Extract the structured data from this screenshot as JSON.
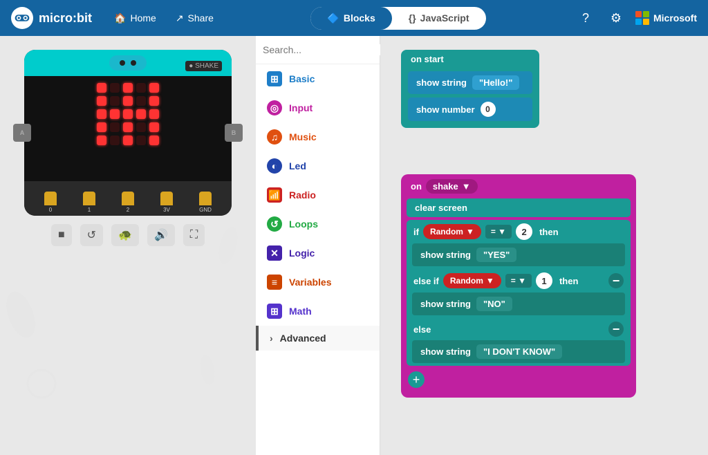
{
  "header": {
    "logo_text": "micro:bit",
    "home_label": "Home",
    "share_label": "Share",
    "blocks_label": "Blocks",
    "javascript_label": "JavaScript",
    "active_tab": "blocks"
  },
  "toolbox": {
    "search_placeholder": "Search...",
    "items": [
      {
        "id": "basic",
        "label": "Basic",
        "color": "#1e7ec8",
        "icon": "⊞"
      },
      {
        "id": "input",
        "label": "Input",
        "color": "#c020a0",
        "icon": "◎"
      },
      {
        "id": "music",
        "label": "Music",
        "color": "#e05010",
        "icon": "🎵"
      },
      {
        "id": "led",
        "label": "Led",
        "color": "#2244aa",
        "icon": "◐"
      },
      {
        "id": "radio",
        "label": "Radio",
        "color": "#cc2222",
        "icon": "📶"
      },
      {
        "id": "loops",
        "label": "Loops",
        "color": "#22aa44",
        "icon": "↺"
      },
      {
        "id": "logic",
        "label": "Logic",
        "color": "#4422aa",
        "icon": "✕"
      },
      {
        "id": "variables",
        "label": "Variables",
        "color": "#cc4400",
        "icon": "≡"
      },
      {
        "id": "math",
        "label": "Math",
        "color": "#5533cc",
        "icon": "⊞"
      },
      {
        "id": "advanced",
        "label": "Advanced",
        "color": "#333",
        "icon": "›"
      }
    ]
  },
  "blocks": {
    "on_start": {
      "header": "on start",
      "rows": [
        {
          "type": "show_string",
          "label": "show string",
          "value": "\"Hello!\""
        },
        {
          "type": "show_number",
          "label": "show number",
          "value": "0"
        }
      ]
    },
    "on_shake": {
      "header": "on",
      "event": "shake",
      "clear_screen": "clear screen",
      "if_block": {
        "keyword": "if",
        "condition_label": "Random",
        "operator": "=",
        "value": "2",
        "then": "then",
        "show_label": "show string",
        "show_value": "\"YES\""
      },
      "else_if_block": {
        "keyword": "else if",
        "condition_label": "Random",
        "operator": "=",
        "value": "1",
        "then": "then",
        "show_label": "show string",
        "show_value": "\"NO\""
      },
      "else_block": {
        "keyword": "else",
        "show_label": "show string",
        "show_value": "\"I DON'T KNOW\""
      }
    }
  },
  "simulator": {
    "labels": [
      "A",
      "B",
      "SHAKE"
    ],
    "pins": [
      "0",
      "1",
      "2",
      "3V",
      "GND"
    ]
  }
}
